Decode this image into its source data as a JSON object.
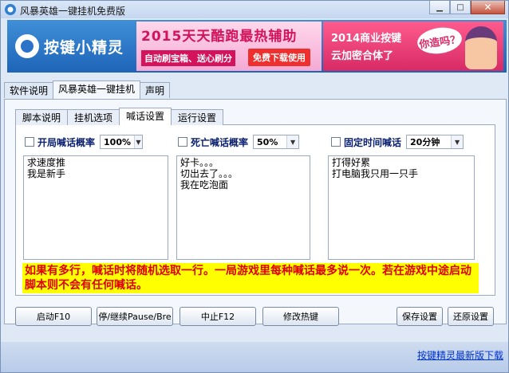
{
  "window": {
    "title": "风暴英雄一键挂机免费版"
  },
  "header": {
    "logo_text": "按键小精灵",
    "ad1": {
      "title": "2015天天酷跑最热辅助",
      "subtitle": "自动刷宝箱、送心刷分",
      "button": "免费下载使用"
    },
    "ad2": {
      "line1": "2014商业按键",
      "line2": "云加密合体了",
      "bubble": "你造吗？"
    }
  },
  "top_tabs": [
    "软件说明",
    "风暴英雄一键挂机",
    "声明"
  ],
  "inner_tabs": [
    "脚本说明",
    "挂机选项",
    "喊话设置",
    "运行设置"
  ],
  "options": [
    {
      "label": "开局喊话概率",
      "value": "100%"
    },
    {
      "label": "死亡喊话概率",
      "value": "50%"
    },
    {
      "label": "固定时间喊话",
      "value": "20分钟"
    }
  ],
  "messages": {
    "start": [
      "求速度推",
      "我是新手"
    ],
    "death": [
      "好卡。。。",
      "切出去了。。。",
      "我在吃泡面"
    ],
    "timed": [
      "打得好累",
      "打电脑我只用一只手"
    ]
  },
  "notice": "如果有多行，喊话时将随机选取一行。一局游戏里每种喊话最多说一次。若在游戏中途启动脚本则不会有任何喊话。",
  "buttons": {
    "start": "启动F10",
    "pause": "停/继续Pause/Bre",
    "stop": "中止F12",
    "hotkey": "修改热键",
    "save": "保存设置",
    "restore": "还原设置"
  },
  "footer_link": "按键精灵最新版下载"
}
